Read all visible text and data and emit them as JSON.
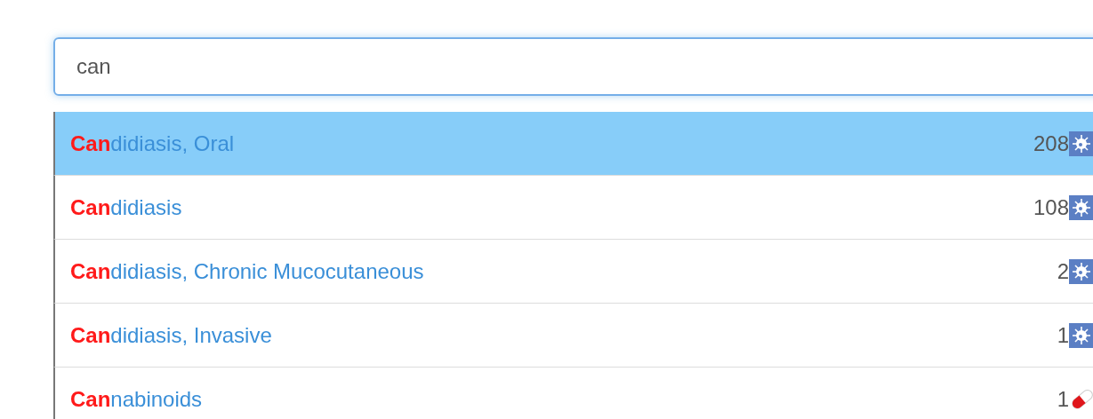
{
  "search": {
    "value": "can"
  },
  "suggestions": [
    {
      "label": "**Can**didiasis, Oral",
      "count": "208",
      "kind": "virus",
      "selected": true
    },
    {
      "label": "**Can**didiasis",
      "count": "108",
      "kind": "virus",
      "selected": false
    },
    {
      "label": "**Can**didiasis, Chronic Mucocutaneous",
      "count": "2",
      "kind": "virus",
      "selected": false
    },
    {
      "label": "**Can**didiasis, Invasive",
      "count": "1",
      "kind": "virus",
      "selected": false
    },
    {
      "label": "**Can**nabinoids",
      "count": "1",
      "kind": "drug",
      "selected": false
    }
  ]
}
